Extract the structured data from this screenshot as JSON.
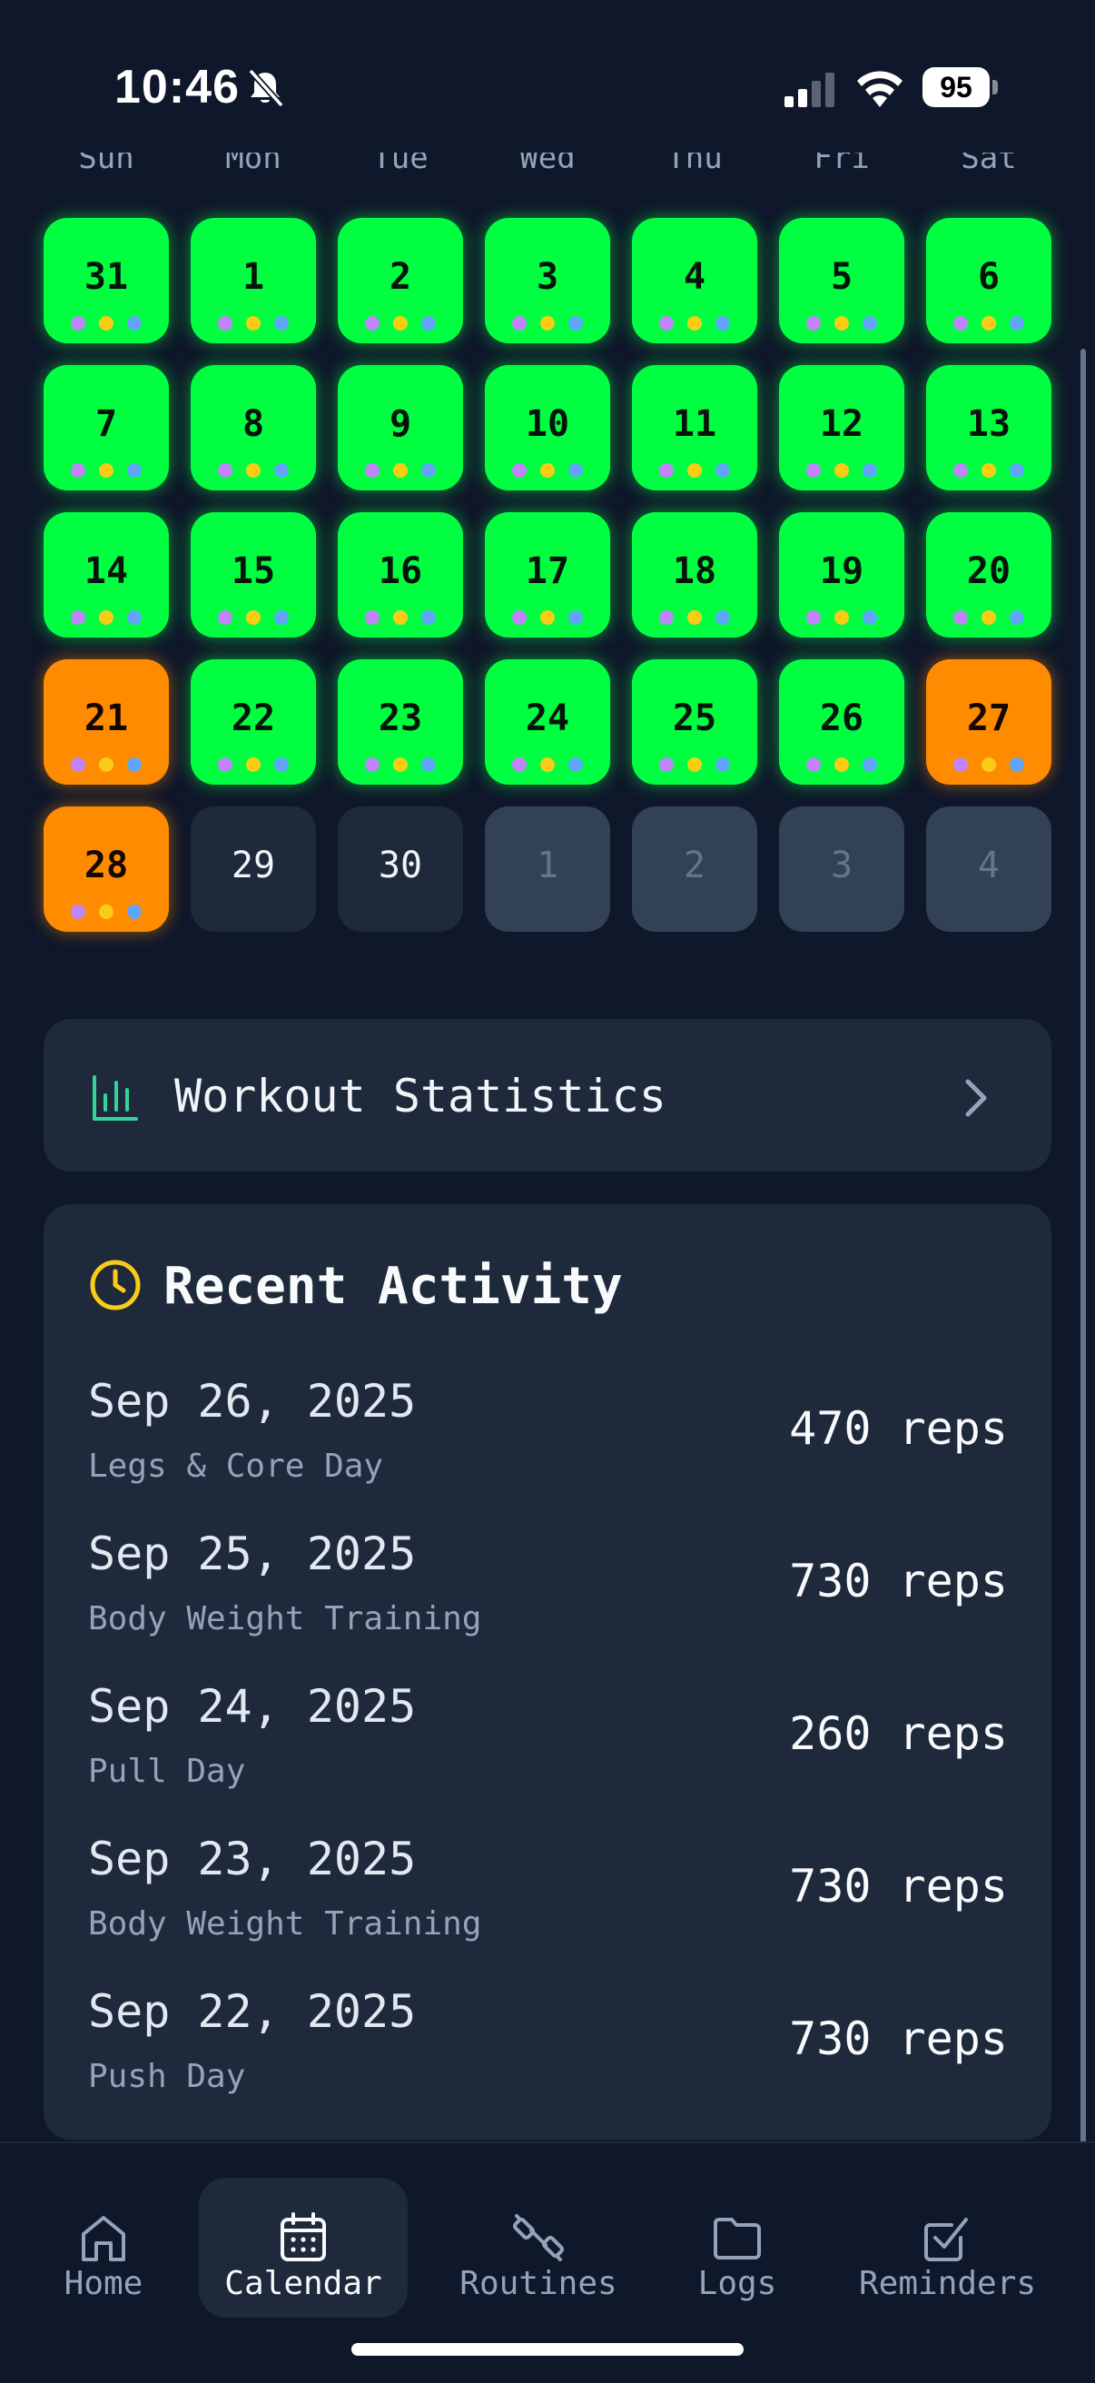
{
  "status_bar": {
    "time": "10:46",
    "battery": "95"
  },
  "calendar": {
    "weekdays": [
      "Sun",
      "Mon",
      "Tue",
      "Wed",
      "Thu",
      "Fri",
      "Sat"
    ],
    "weeks": [
      [
        {
          "day": "31",
          "status": "green"
        },
        {
          "day": "1",
          "status": "green"
        },
        {
          "day": "2",
          "status": "green"
        },
        {
          "day": "3",
          "status": "green"
        },
        {
          "day": "4",
          "status": "green"
        },
        {
          "day": "5",
          "status": "green"
        },
        {
          "day": "6",
          "status": "green"
        }
      ],
      [
        {
          "day": "7",
          "status": "green"
        },
        {
          "day": "8",
          "status": "green"
        },
        {
          "day": "9",
          "status": "green"
        },
        {
          "day": "10",
          "status": "green"
        },
        {
          "day": "11",
          "status": "green"
        },
        {
          "day": "12",
          "status": "green"
        },
        {
          "day": "13",
          "status": "green"
        }
      ],
      [
        {
          "day": "14",
          "status": "green"
        },
        {
          "day": "15",
          "status": "green"
        },
        {
          "day": "16",
          "status": "green"
        },
        {
          "day": "17",
          "status": "green"
        },
        {
          "day": "18",
          "status": "green"
        },
        {
          "day": "19",
          "status": "green"
        },
        {
          "day": "20",
          "status": "green"
        }
      ],
      [
        {
          "day": "21",
          "status": "orange"
        },
        {
          "day": "22",
          "status": "green"
        },
        {
          "day": "23",
          "status": "green"
        },
        {
          "day": "24",
          "status": "green"
        },
        {
          "day": "25",
          "status": "green"
        },
        {
          "day": "26",
          "status": "green"
        },
        {
          "day": "27",
          "status": "orange"
        }
      ],
      [
        {
          "day": "28",
          "status": "orange"
        },
        {
          "day": "29",
          "status": "empty"
        },
        {
          "day": "30",
          "status": "empty"
        },
        {
          "day": "1",
          "status": "other"
        },
        {
          "day": "2",
          "status": "other"
        },
        {
          "day": "3",
          "status": "other"
        },
        {
          "day": "4",
          "status": "other"
        }
      ]
    ],
    "dot_colors": [
      "#c084fc",
      "#facc15",
      "#60a5fa"
    ],
    "status_colors": {
      "green": "#00ff41",
      "orange": "#ff8c00",
      "empty": "#1e293b",
      "other": "#334155"
    }
  },
  "stats_card": {
    "label": "Workout Statistics",
    "icon": "bar-chart-icon"
  },
  "recent_activity": {
    "title": "Recent Activity",
    "icon": "clock-icon",
    "items": [
      {
        "date": "Sep 26, 2025",
        "name": "Legs & Core Day",
        "reps": "470 reps"
      },
      {
        "date": "Sep 25, 2025",
        "name": "Body Weight Training",
        "reps": "730 reps"
      },
      {
        "date": "Sep 24, 2025",
        "name": "Pull Day",
        "reps": "260 reps"
      },
      {
        "date": "Sep 23, 2025",
        "name": "Body Weight Training",
        "reps": "730 reps"
      },
      {
        "date": "Sep 22, 2025",
        "name": "Push Day",
        "reps": "730 reps"
      }
    ]
  },
  "nav": {
    "active": "Calendar",
    "tabs": [
      {
        "label": "Home",
        "icon": "home-icon"
      },
      {
        "label": "Calendar",
        "icon": "calendar-icon"
      },
      {
        "label": "Routines",
        "icon": "dumbbell-icon"
      },
      {
        "label": "Logs",
        "icon": "folder-icon"
      },
      {
        "label": "Reminders",
        "icon": "checkbox-icon"
      }
    ]
  }
}
